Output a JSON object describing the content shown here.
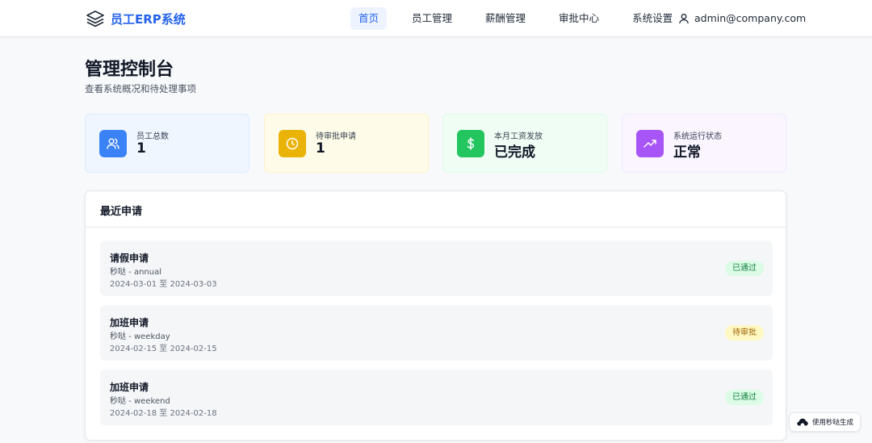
{
  "header": {
    "logo_text": "员工ERP系统",
    "nav": [
      {
        "label": "首页",
        "active": true
      },
      {
        "label": "员工管理",
        "active": false
      },
      {
        "label": "薪酬管理",
        "active": false
      },
      {
        "label": "审批中心",
        "active": false
      },
      {
        "label": "系统设置",
        "active": false
      }
    ],
    "user_email": "admin@company.com"
  },
  "page": {
    "title": "管理控制台",
    "subtitle": "查看系统概况和待处理事项"
  },
  "stats": [
    {
      "label": "员工总数",
      "value": "1",
      "icon": "users-icon",
      "accent": "#3b82f6",
      "bg": "#eff6ff",
      "border": "#dbeafe"
    },
    {
      "label": "待审批申请",
      "value": "1",
      "icon": "clock-icon",
      "accent": "#eab308",
      "bg": "#fefce8",
      "border": "#fef3c7"
    },
    {
      "label": "本月工资发放",
      "value": "已完成",
      "icon": "dollar-icon",
      "accent": "#22c55e",
      "bg": "#f0fdf4",
      "border": "#dcfce7"
    },
    {
      "label": "系统运行状态",
      "value": "正常",
      "icon": "trending-up-icon",
      "accent": "#a855f7",
      "bg": "#faf5ff",
      "border": "#f3e8ff"
    }
  ],
  "recent": {
    "title": "最近申请",
    "items": [
      {
        "title": "请假申请",
        "sub": "秒哒 - annual",
        "date": "2024-03-01 至 2024-03-03",
        "status": "已通过",
        "status_bg": "#dcfce7",
        "status_color": "#15803d"
      },
      {
        "title": "加班申请",
        "sub": "秒哒 - weekday",
        "date": "2024-02-15 至 2024-02-15",
        "status": "待审批",
        "status_bg": "#fef9c3",
        "status_color": "#a16207"
      },
      {
        "title": "加班申请",
        "sub": "秒哒 - weekend",
        "date": "2024-02-18 至 2024-02-18",
        "status": "已通过",
        "status_bg": "#dcfce7",
        "status_color": "#15803d"
      }
    ]
  },
  "footer_badge": {
    "label": "使用秒哒生成"
  }
}
